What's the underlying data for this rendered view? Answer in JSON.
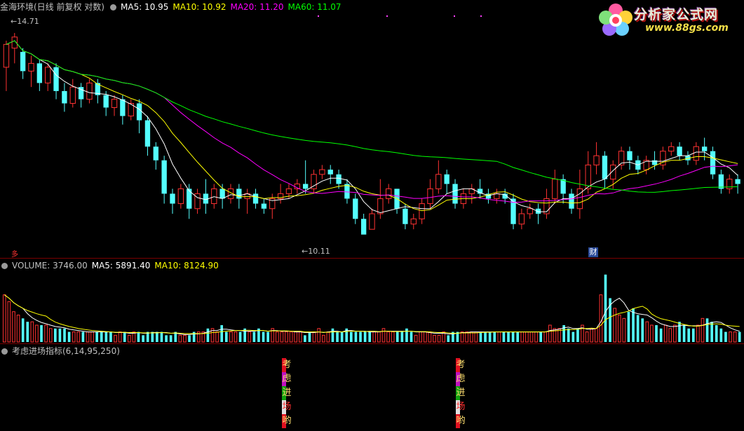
{
  "colors": {
    "up": "#ff3232",
    "down": "#54ffff",
    "ma5": "#ffffff",
    "ma10": "#ffff00",
    "ma20": "#ff00ff",
    "ma60": "#00ff00",
    "grid": "#7a0000",
    "volma5": "#ffffff",
    "volma10": "#ffff00"
  },
  "price_header": {
    "title": "金海环境(日线 前复权 对数)",
    "ma5": "MA5: 10.95",
    "ma10": "MA10: 10.92",
    "ma20": "MA20: 11.20",
    "ma60": "MA60: 11.07"
  },
  "volume_header": {
    "title": "VOLUME: 3746.00",
    "ma5": "MA5: 5891.40",
    "ma10": "MA10: 8124.90"
  },
  "indicator_header": {
    "title": "考虑进场指标(6,14,95,250)"
  },
  "logo": {
    "name": "分析家公式网",
    "url": "www.88gs.com"
  },
  "markers": {
    "high": "14.71",
    "low": "10.11",
    "tag_left": "多",
    "tag_right": "财"
  },
  "signal": {
    "chars": [
      "考",
      "虑",
      "进",
      "场",
      "哟"
    ],
    "colors": [
      "#e01020",
      "#c010c0",
      "#10a010",
      "#e0e0e0",
      "#e01020"
    ]
  },
  "chart_data": [
    {
      "type": "candlestick",
      "scale": "log",
      "ylim": [
        9.9,
        15.2
      ],
      "series": [
        {
          "name": "MA5",
          "values": "see candles"
        },
        {
          "name": "MA10"
        },
        {
          "name": "MA20"
        },
        {
          "name": "MA60"
        }
      ],
      "candles": [
        [
          13.8,
          14.4,
          13.2,
          14.5
        ],
        [
          14.3,
          14.6,
          13.9,
          14.71
        ],
        [
          14.2,
          13.7,
          13.5,
          14.3
        ],
        [
          13.7,
          13.9,
          13.3,
          14.1
        ],
        [
          13.9,
          13.4,
          13.2,
          14.0
        ],
        [
          13.4,
          13.8,
          13.2,
          13.9
        ],
        [
          13.8,
          13.2,
          13.0,
          13.9
        ],
        [
          13.2,
          12.9,
          12.7,
          13.4
        ],
        [
          12.9,
          13.3,
          12.8,
          13.5
        ],
        [
          13.3,
          13.0,
          12.8,
          13.4
        ],
        [
          13.0,
          13.4,
          12.9,
          13.5
        ],
        [
          13.4,
          13.1,
          12.9,
          13.5
        ],
        [
          13.1,
          12.8,
          12.6,
          13.2
        ],
        [
          12.8,
          13.0,
          12.6,
          13.1
        ],
        [
          13.0,
          12.6,
          12.4,
          13.1
        ],
        [
          12.6,
          12.9,
          12.5,
          13.0
        ],
        [
          12.9,
          12.5,
          12.2,
          13.0
        ],
        [
          12.5,
          11.9,
          11.7,
          12.6
        ],
        [
          11.9,
          11.6,
          11.4,
          12.0
        ],
        [
          11.6,
          10.9,
          10.7,
          11.7
        ],
        [
          10.9,
          10.7,
          10.5,
          11.0
        ],
        [
          10.7,
          11.0,
          10.6,
          11.1
        ],
        [
          11.0,
          10.6,
          10.4,
          11.1
        ],
        [
          10.6,
          10.9,
          10.5,
          11.0
        ],
        [
          10.9,
          10.7,
          10.5,
          11.2
        ],
        [
          10.7,
          11.0,
          10.6,
          11.1
        ],
        [
          11.0,
          10.8,
          10.6,
          11.1
        ],
        [
          10.8,
          11.0,
          10.7,
          11.1
        ],
        [
          11.0,
          10.8,
          10.6,
          11.1
        ],
        [
          10.8,
          10.9,
          10.5,
          11.0
        ],
        [
          10.9,
          10.7,
          10.6,
          11.0
        ],
        [
          10.7,
          10.6,
          10.5,
          10.8
        ],
        [
          10.6,
          10.8,
          10.4,
          10.9
        ],
        [
          10.8,
          10.9,
          10.7,
          11.1
        ],
        [
          10.9,
          11.0,
          10.8,
          11.1
        ],
        [
          11.0,
          11.1,
          10.9,
          11.2
        ],
        [
          11.1,
          11.0,
          10.9,
          11.6
        ],
        [
          11.0,
          11.3,
          10.9,
          11.4
        ],
        [
          11.3,
          11.4,
          11.2,
          11.5
        ],
        [
          11.4,
          11.3,
          11.1,
          11.5
        ],
        [
          11.3,
          11.1,
          11.0,
          11.4
        ],
        [
          11.1,
          10.8,
          10.7,
          11.2
        ],
        [
          10.8,
          10.4,
          10.3,
          10.9
        ],
        [
          10.4,
          10.1,
          10.11,
          10.5
        ],
        [
          10.2,
          10.5,
          10.2,
          10.6
        ],
        [
          10.5,
          10.8,
          10.4,
          11.2
        ],
        [
          10.8,
          11.0,
          10.7,
          11.1
        ],
        [
          11.0,
          10.6,
          10.5,
          11.0
        ],
        [
          10.6,
          10.3,
          10.2,
          10.7
        ],
        [
          10.3,
          10.4,
          10.2,
          10.5
        ],
        [
          10.4,
          10.7,
          10.3,
          10.8
        ],
        [
          10.7,
          11.0,
          10.6,
          11.2
        ],
        [
          11.0,
          11.3,
          10.9,
          11.6
        ],
        [
          11.3,
          11.1,
          10.9,
          11.4
        ],
        [
          11.1,
          10.7,
          10.6,
          11.2
        ],
        [
          10.7,
          10.9,
          10.6,
          11.0
        ],
        [
          10.9,
          11.0,
          10.7,
          11.1
        ],
        [
          11.0,
          10.9,
          10.8,
          11.2
        ],
        [
          10.9,
          10.8,
          10.7,
          11.0
        ],
        [
          10.8,
          10.9,
          10.7,
          11.0
        ],
        [
          10.9,
          10.8,
          10.7,
          11.0
        ],
        [
          10.8,
          10.3,
          10.2,
          10.9
        ],
        [
          10.3,
          10.5,
          10.2,
          10.6
        ],
        [
          10.5,
          10.6,
          10.4,
          10.7
        ],
        [
          10.6,
          10.5,
          10.3,
          10.7
        ],
        [
          10.5,
          10.8,
          10.4,
          11.0
        ],
        [
          10.8,
          11.2,
          10.7,
          11.4
        ],
        [
          11.2,
          10.9,
          10.7,
          11.3
        ],
        [
          10.9,
          10.6,
          10.5,
          11.0
        ],
        [
          10.6,
          11.0,
          10.4,
          11.4
        ],
        [
          11.0,
          11.5,
          10.9,
          11.8
        ],
        [
          11.5,
          11.7,
          11.3,
          12.0
        ],
        [
          11.7,
          11.2,
          11.0,
          11.8
        ],
        [
          11.2,
          11.5,
          11.0,
          11.6
        ],
        [
          11.5,
          11.8,
          11.4,
          11.9
        ],
        [
          11.8,
          11.6,
          11.4,
          11.9
        ],
        [
          11.6,
          11.4,
          11.3,
          11.7
        ],
        [
          11.4,
          11.6,
          11.3,
          11.7
        ],
        [
          11.6,
          11.5,
          11.4,
          11.8
        ],
        [
          11.5,
          11.8,
          11.4,
          11.9
        ],
        [
          11.8,
          11.9,
          11.7,
          12.0
        ],
        [
          11.9,
          11.7,
          11.6,
          12.0
        ],
        [
          11.7,
          11.6,
          11.5,
          11.8
        ],
        [
          11.6,
          11.9,
          11.5,
          12.0
        ],
        [
          11.9,
          11.8,
          11.6,
          12.1
        ],
        [
          11.8,
          11.3,
          11.2,
          11.9
        ],
        [
          11.3,
          11.0,
          10.9,
          11.4
        ],
        [
          11.0,
          11.2,
          10.9,
          11.3
        ],
        [
          11.2,
          11.1,
          10.9,
          11.3
        ]
      ]
    },
    {
      "type": "bar",
      "title": "VOLUME",
      "values": [
        14,
        12,
        9,
        8,
        7,
        6,
        6,
        5,
        5,
        5,
        4,
        4,
        4,
        4,
        3,
        3,
        3,
        3,
        3,
        3,
        3,
        3,
        3,
        3,
        2,
        3,
        3,
        2,
        3,
        3,
        2,
        3,
        3,
        3,
        3,
        2,
        2,
        3,
        2,
        2,
        2,
        3,
        3,
        3,
        4,
        4,
        3,
        5,
        3,
        3,
        3,
        3,
        4,
        3,
        3,
        4,
        3,
        3,
        4,
        3,
        3,
        3,
        3,
        3,
        3,
        2,
        3,
        3,
        4,
        2,
        3,
        4,
        3,
        3,
        4,
        3,
        3,
        3,
        3,
        3,
        3,
        3,
        4,
        3,
        3,
        3,
        3,
        4,
        3,
        2,
        3,
        3,
        3,
        2,
        2,
        3,
        2,
        3,
        3,
        3,
        3,
        3,
        3,
        3,
        3,
        3,
        3,
        3,
        3,
        3,
        3,
        3,
        3,
        3,
        3,
        3,
        3,
        3,
        5,
        4,
        4,
        5,
        4,
        3,
        4,
        5,
        3,
        4,
        4,
        14,
        20,
        13,
        10,
        8,
        7,
        9,
        10,
        8,
        7,
        6,
        5,
        5,
        4,
        5,
        4,
        5,
        6,
        5,
        4,
        4,
        5,
        7,
        7,
        6,
        5,
        4,
        3,
        3,
        3,
        3
      ],
      "series": [
        {
          "name": "MA5"
        },
        {
          "name": "MA10"
        }
      ]
    }
  ]
}
